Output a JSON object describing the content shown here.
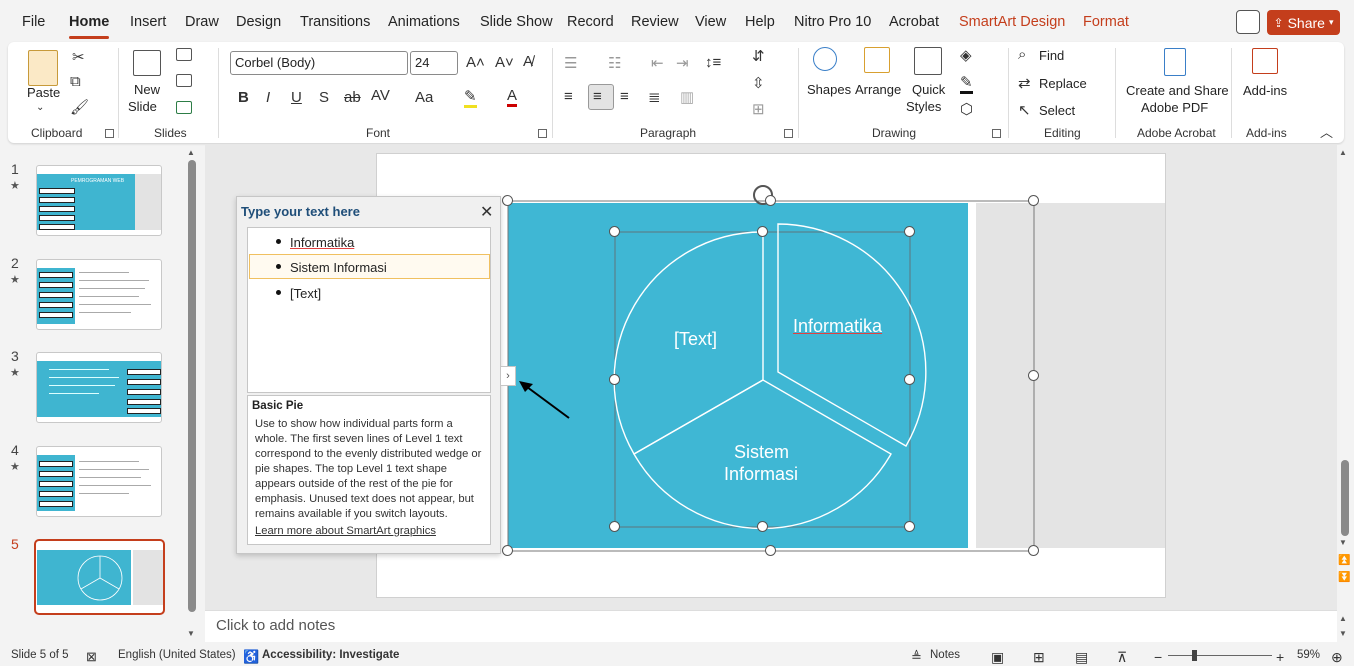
{
  "menu": {
    "items": [
      "File",
      "Home",
      "Insert",
      "Draw",
      "Design",
      "Transitions",
      "Animations",
      "Slide Show",
      "Record",
      "Review",
      "View",
      "Help",
      "Nitro Pro 10",
      "Acrobat"
    ],
    "context": [
      "SmartArt Design",
      "Format"
    ],
    "active": "Home",
    "share": "Share"
  },
  "ribbon": {
    "clipboard": {
      "paste": "Paste",
      "label": "Clipboard"
    },
    "slides": {
      "new_slide_1": "New",
      "new_slide_2": "Slide",
      "label": "Slides"
    },
    "font": {
      "name": "Corbel (Body)",
      "size": "24",
      "label": "Font"
    },
    "paragraph": {
      "label": "Paragraph"
    },
    "drawing": {
      "shapes": "Shapes",
      "arrange": "Arrange",
      "quick_1": "Quick",
      "quick_2": "Styles",
      "label": "Drawing"
    },
    "editing": {
      "find": "Find",
      "replace": "Replace",
      "select": "Select",
      "label": "Editing"
    },
    "acrobat": {
      "create_1": "Create and Share",
      "create_2": "Adobe PDF",
      "label": "Adobe Acrobat"
    },
    "addins": {
      "button": "Add-ins",
      "label": "Add-ins"
    }
  },
  "thumbnails": {
    "numbers": [
      "1",
      "2",
      "3",
      "4",
      "5"
    ],
    "slide1_title": "PEMROGRAMAN WEB"
  },
  "text_pane": {
    "title": "Type your text here",
    "items": [
      "Informatika",
      "Sistem Informasi",
      "[Text]"
    ],
    "desc_title": "Basic Pie",
    "desc_body": "Use to show how individual parts form a whole. The first seven lines of Level 1 text correspond to the evenly distributed wedge or pie shapes. The top Level 1 text shape appears outside of the rest of the pie for emphasis. Unused text does not appear, but remains available if you switch layouts.",
    "desc_link": "Learn more about SmartArt graphics"
  },
  "smartart": {
    "wedge_text": "[Text]",
    "wedge_informatika": "Informatika",
    "wedge_sistem_1": "Sistem",
    "wedge_sistem_2": "Informasi"
  },
  "notes": {
    "placeholder": "Click to add notes"
  },
  "status": {
    "slide": "Slide 5 of 5",
    "language": "English (United States)",
    "accessibility": "Accessibility: Investigate",
    "notes": "Notes",
    "zoom": "59%"
  },
  "colors": {
    "accent": "#c43e1c",
    "slide_blue": "#3fb7d4"
  }
}
